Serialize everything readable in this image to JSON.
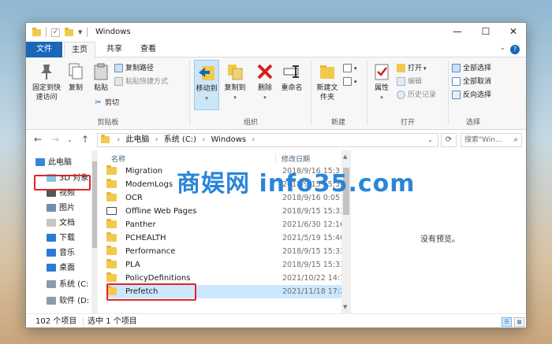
{
  "window": {
    "title": "Windows",
    "minimize": "—",
    "maximize": "☐",
    "close": "✕"
  },
  "tabs": {
    "file": "文件",
    "home": "主页",
    "share": "共享",
    "view": "查看"
  },
  "ribbon": {
    "clipboard": {
      "pin_label": "固定到快速访问",
      "copy_label": "复制",
      "paste_label": "粘贴",
      "copy_path": "复制路径",
      "paste_shortcut": "粘贴快捷方式",
      "cut": "剪切",
      "group_label": "剪贴板"
    },
    "organize": {
      "move_to": "移动到",
      "copy_to": "复制到",
      "delete": "删除",
      "rename": "重命名",
      "group_label": "组织"
    },
    "new": {
      "new_folder": "新建文件夹",
      "group_label": "新建"
    },
    "open": {
      "properties": "属性",
      "open": "打开",
      "edit": "编辑",
      "history": "历史记录",
      "group_label": "打开"
    },
    "select": {
      "select_all": "全部选择",
      "select_none": "全部取消",
      "invert": "反向选择",
      "group_label": "选择"
    }
  },
  "address": {
    "path": [
      "此电脑",
      "系统 (C:)",
      "Windows"
    ],
    "search_placeholder": "搜索\"Win..."
  },
  "nav": {
    "items": [
      {
        "label": "此电脑",
        "icon": "computer-icon"
      },
      {
        "label": "3D 对象",
        "icon": "3d-objects-icon"
      },
      {
        "label": "视频",
        "icon": "video-icon"
      },
      {
        "label": "图片",
        "icon": "pictures-icon"
      },
      {
        "label": "文档",
        "icon": "documents-icon"
      },
      {
        "label": "下载",
        "icon": "download-icon"
      },
      {
        "label": "音乐",
        "icon": "music-icon"
      },
      {
        "label": "桌面",
        "icon": "desktop-icon"
      },
      {
        "label": "系统 (C:",
        "icon": "drive-icon"
      },
      {
        "label": "软件 (D:",
        "icon": "drive-icon"
      }
    ]
  },
  "files": {
    "col_name": "名称",
    "col_date": "修改日期",
    "rows": [
      {
        "name": "Migration",
        "date": "2018/9/16 15:3"
      },
      {
        "name": "ModemLogs",
        "date": "2018/9/15 15:3"
      },
      {
        "name": "OCR",
        "date": "2018/9/16 0:05"
      },
      {
        "name": "Offline Web Pages",
        "date": "2018/9/15 15:33"
      },
      {
        "name": "Panther",
        "date": "2021/6/30 12:16"
      },
      {
        "name": "PCHEALTH",
        "date": "2021/5/19 15:40"
      },
      {
        "name": "Performance",
        "date": "2018/9/15 15:33"
      },
      {
        "name": "PLA",
        "date": "2018/9/15 15:33"
      },
      {
        "name": "PolicyDefinitions",
        "date": "2021/10/22 14:1"
      },
      {
        "name": "Prefetch",
        "date": "2021/11/18 17:2"
      }
    ]
  },
  "preview": {
    "message": "没有预览。"
  },
  "status": {
    "count": "102 个项目",
    "selected": "选中 1 个项目"
  },
  "watermark": "商娱网 info35.com",
  "colors": {
    "accent": "#1a66b8",
    "selection": "#cce8ff",
    "highlight_box": "#e02424",
    "watermark": "#1e7fd8"
  }
}
